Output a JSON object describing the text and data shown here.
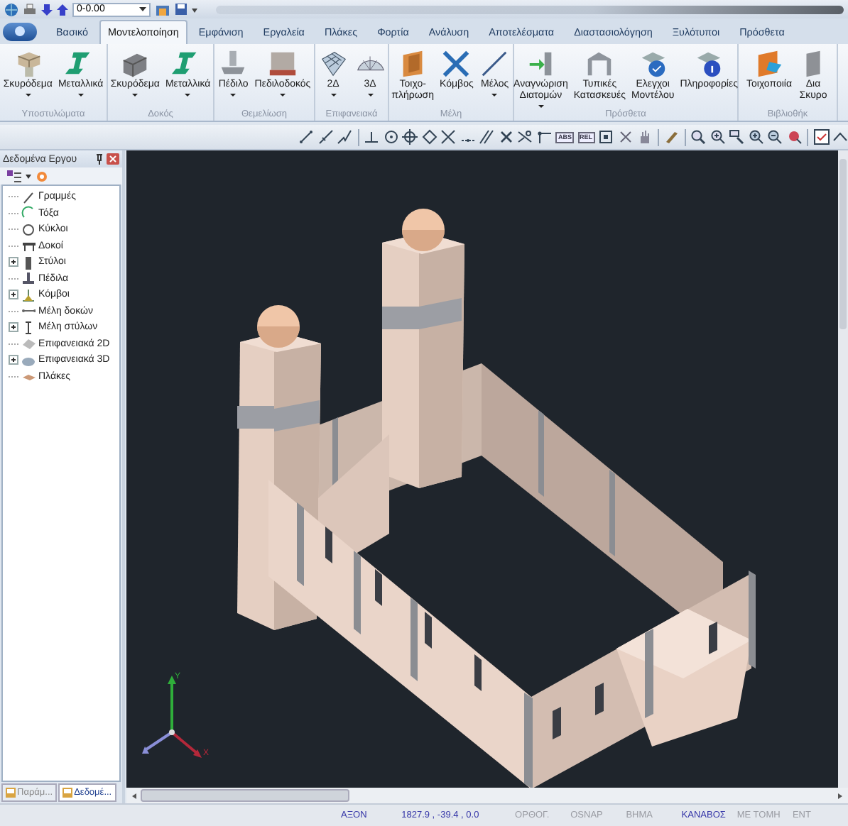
{
  "quick_access": {
    "level_field": {
      "value": "0-0.00"
    }
  },
  "tabs": [
    {
      "label": "Βασικό",
      "selected": false
    },
    {
      "label": "Μοντελοποίηση",
      "selected": true
    },
    {
      "label": "Εμφάνιση",
      "selected": false
    },
    {
      "label": "Εργαλεία",
      "selected": false
    },
    {
      "label": "Πλάκες",
      "selected": false
    },
    {
      "label": "Φορτία",
      "selected": false
    },
    {
      "label": "Ανάλυση",
      "selected": false
    },
    {
      "label": "Αποτελέσματα",
      "selected": false
    },
    {
      "label": "Διαστασιολόγηση",
      "selected": false
    },
    {
      "label": "Ξυλότυποι",
      "selected": false
    },
    {
      "label": "Πρόσθετα",
      "selected": false
    }
  ],
  "ribbon_groups": [
    {
      "label": "Υποστυλώματα",
      "buttons": [
        {
          "label": "Σκυρόδεμα",
          "kind": "concrete-column",
          "dropdown": true
        },
        {
          "label": "Μεταλλικά",
          "kind": "steel-section",
          "dropdown": true
        }
      ]
    },
    {
      "label": "Δοκός",
      "buttons": [
        {
          "label": "Σκυρόδεμα",
          "kind": "concrete-beam",
          "dropdown": true
        },
        {
          "label": "Μεταλλικά",
          "kind": "steel-section",
          "dropdown": true
        }
      ]
    },
    {
      "label": "Θεμελίωση",
      "buttons": [
        {
          "label": "Πέδιλο",
          "kind": "footing",
          "dropdown": true
        },
        {
          "label": "Πεδιλοδοκός",
          "kind": "strip-footing",
          "dropdown": true
        }
      ]
    },
    {
      "label": "Επιφανειακά",
      "buttons": [
        {
          "label": "2Δ",
          "kind": "grid",
          "dropdown": true
        },
        {
          "label": "3Δ",
          "kind": "dome",
          "dropdown": true
        }
      ]
    },
    {
      "label": "Μέλη",
      "buttons": [
        {
          "label": "Τοιχο-\nπλήρωση",
          "kind": "wall",
          "dropdown": false
        },
        {
          "label": "Κόμβος",
          "kind": "node",
          "dropdown": false
        },
        {
          "label": "Μέλος",
          "kind": "member",
          "dropdown": true
        }
      ]
    },
    {
      "label": "Πρόσθετα",
      "buttons": [
        {
          "label": "Αναγνώριση\nΔιατομών",
          "kind": "recognition",
          "dropdown": true
        },
        {
          "label": "Τυπικές\nΚατασκευές",
          "kind": "frame",
          "dropdown": false
        },
        {
          "label": "Ελεγχοι\nΜοντέλου",
          "kind": "check",
          "dropdown": false
        },
        {
          "label": "Πληροφορίες",
          "kind": "info",
          "dropdown": false
        }
      ]
    },
    {
      "label": "Βιβλιοθήκ",
      "buttons": [
        {
          "label": "Τοιχοποιία",
          "kind": "masonry",
          "dropdown": false
        },
        {
          "label": "Δια\nΣκυρο",
          "kind": "block",
          "dropdown": false
        }
      ]
    }
  ],
  "toolbar": {
    "coordinate_modes": [
      "ABS",
      "REL"
    ]
  },
  "panel": {
    "title": "Δεδομένα Εργου",
    "tree": [
      {
        "label": "Γραμμές",
        "kind": "line"
      },
      {
        "label": "Τόξα",
        "kind": "arc"
      },
      {
        "label": "Κύκλοι",
        "kind": "circle"
      },
      {
        "label": "Δοκοί",
        "kind": "beam"
      },
      {
        "label": "Στύλοι",
        "kind": "column",
        "expanded": false
      },
      {
        "label": "Πέδιλα",
        "kind": "footing"
      },
      {
        "label": "Κόμβοι",
        "kind": "node",
        "expanded": false
      },
      {
        "label": "Μέλη δοκών",
        "kind": "beam-member"
      },
      {
        "label": "Μέλη στύλων",
        "kind": "column-member",
        "expanded": false
      },
      {
        "label": "Επιφανειακά 2D",
        "kind": "surface2d"
      },
      {
        "label": "Επιφανειακά 3D",
        "kind": "surface3d",
        "expanded": false
      },
      {
        "label": "Πλάκες",
        "kind": "slab"
      }
    ],
    "bottom_tabs": [
      {
        "label": "Παράμ...",
        "selected": false
      },
      {
        "label": "Δεδομέ...",
        "selected": true
      }
    ]
  },
  "viewport": {
    "axes": {
      "y": "Y",
      "x": "X"
    }
  },
  "status_bar": {
    "mode": "ΑΞΟΝ",
    "coordinates": "1827.9 , -39.4 , 0.0",
    "toggles": [
      {
        "label": "ΟΡΘΟΓ.",
        "on": false
      },
      {
        "label": "OSNAP",
        "on": false
      },
      {
        "label": "ΒΗΜΑ",
        "on": false
      },
      {
        "label": "ΚΑΝΑΒΟΣ",
        "on": true
      },
      {
        "label": "ΜΕ ΤΟΜΗ",
        "on": false
      },
      {
        "label": "ΕΝΤ",
        "on": false
      }
    ]
  }
}
